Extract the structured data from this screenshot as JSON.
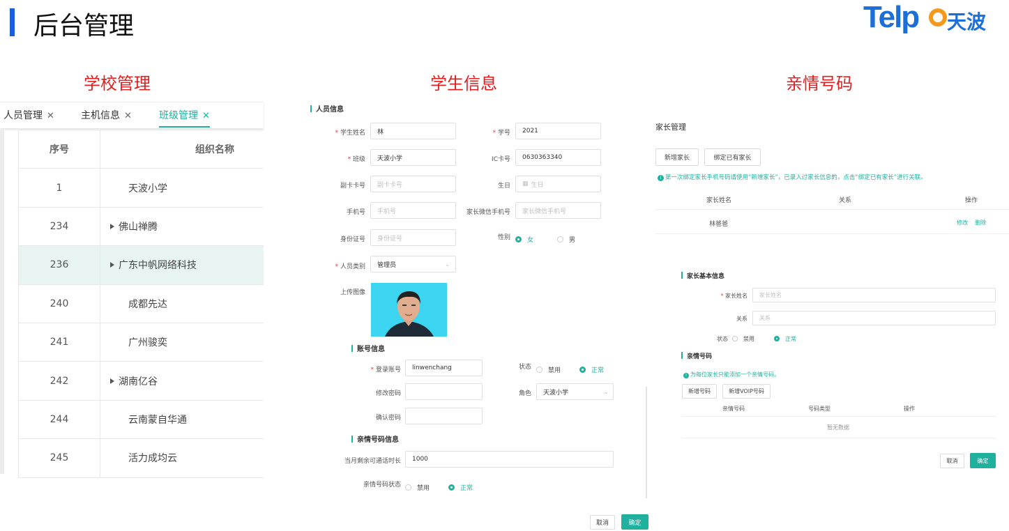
{
  "header": {
    "title": "后台管理",
    "logo_text": "Telp",
    "logo_cn": "天波"
  },
  "sections": {
    "school": "学校管理",
    "student": "学生信息",
    "family": "亲情号码"
  },
  "left": {
    "tabs": [
      {
        "label": "人员管理",
        "close": "✕"
      },
      {
        "label": "主机信息",
        "close": "✕"
      },
      {
        "label": "班级管理",
        "close": "✕"
      }
    ],
    "columns": [
      "序号",
      "组织名称"
    ],
    "rows": [
      {
        "id": "1",
        "name": "天波小学",
        "expandable": false
      },
      {
        "id": "234",
        "name": "佛山禅腾",
        "expandable": true
      },
      {
        "id": "236",
        "name": "广东中帆网络科技",
        "expandable": true
      },
      {
        "id": "240",
        "name": "成都先达",
        "expandable": false
      },
      {
        "id": "241",
        "name": "广州骏奕",
        "expandable": false
      },
      {
        "id": "242",
        "name": "湖南亿谷",
        "expandable": true
      },
      {
        "id": "244",
        "name": "云南蒙自华通",
        "expandable": false
      },
      {
        "id": "245",
        "name": "活力成均云",
        "expandable": false
      }
    ]
  },
  "student": {
    "person_info": "人员信息",
    "name_label": "学生姓名",
    "name_value": "林",
    "stuno_label": "学号",
    "stuno_value": "2021",
    "class_label": "班级",
    "class_value": "天波小学",
    "ic_label": "IC卡号",
    "ic_value": "0630363340",
    "subcard_label": "副卡卡号",
    "subcard_ph": "副卡卡号",
    "birthday_label": "生日",
    "birthday_ph": "生日",
    "phone_label": "手机号",
    "phone_ph": "手机号",
    "wx_label": "家长微信手机号",
    "wx_ph": "家长微信手机号",
    "idcard_label": "身份证号",
    "idcard_ph": "身份证号",
    "gender_label": "性别",
    "gender_female": "女",
    "gender_male": "男",
    "type_label": "人员类别",
    "type_value": "管理员",
    "upload_label": "上传图像",
    "account_info": "账号信息",
    "login_label": "登录账号",
    "login_value": "linwenchang",
    "status_label": "状态",
    "status_disabled": "禁用",
    "status_normal": "正常",
    "pwd_label": "修改密码",
    "role_label": "角色",
    "role_value": "天波小学",
    "pwd2_label": "确认密码",
    "family_info": "亲情号码信息",
    "remain_label": "当月剩余可通话时长",
    "remain_value": "1000",
    "fstatus_label": "亲情号码状态",
    "fstatus_disabled": "禁用",
    "fstatus_normal": "正常",
    "cancel": "取消",
    "confirm": "确定"
  },
  "family": {
    "title": "家长管理",
    "add_parent": "新增家长",
    "bind_parent": "绑定已有家长",
    "tip": "第一次绑定家长手机号码请使用“新增家长”，已录入过家长信息的，点击“绑定已有家长”进行关联。",
    "col_name": "家长姓名",
    "col_relation": "关系",
    "col_ops": "操作",
    "row_name": "林爸爸",
    "op_edit": "修改",
    "op_delete": "删除",
    "basic_info": "家长基本信息",
    "pname_label": "家长姓名",
    "pname_ph": "家长姓名",
    "relation_label": "关系",
    "relation_ph": "关系",
    "state_label": "状态",
    "state_disabled": "禁用",
    "state_normal": "正常",
    "kin_title": "亲情号码",
    "kin_tip": "为每位家长只能添加一个亲情号码。",
    "add_number": "新增号码",
    "add_voip": "新增VOIP号码",
    "kcol_number": "亲情号码",
    "kcol_type": "号码类型",
    "kcol_ops": "操作",
    "no_data": "暂无数据",
    "cancel": "取消",
    "confirm": "确定"
  }
}
